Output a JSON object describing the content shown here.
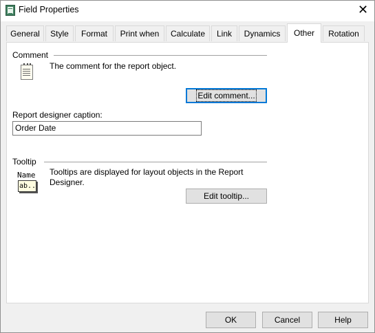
{
  "window": {
    "title": "Field Properties",
    "close_glyph": "✕"
  },
  "tabs": [
    {
      "label": "General"
    },
    {
      "label": "Style"
    },
    {
      "label": "Format"
    },
    {
      "label": "Print when"
    },
    {
      "label": "Calculate"
    },
    {
      "label": "Link"
    },
    {
      "label": "Dynamics"
    },
    {
      "label": "Other",
      "active": true
    },
    {
      "label": "Rotation"
    }
  ],
  "comment": {
    "section_label": "Comment",
    "icon": "notepad-icon",
    "description": "The comment for the report object.",
    "button_label": "Edit comment..."
  },
  "caption": {
    "label": "Report designer caption:",
    "value": "Order Date"
  },
  "tooltip": {
    "section_label": "Tooltip",
    "icon_name_text": "Name",
    "icon_box_text": "ab..",
    "description_line1": "Tooltips are displayed for layout objects in the Report",
    "description_line2": "Designer.",
    "button_label": "Edit tooltip..."
  },
  "footer": {
    "ok_label": "OK",
    "cancel_label": "Cancel",
    "help_label": "Help"
  },
  "colors": {
    "focus_border": "#0078d7",
    "button_face": "#e1e1e1",
    "dialog_bg": "#f0f0f0"
  }
}
